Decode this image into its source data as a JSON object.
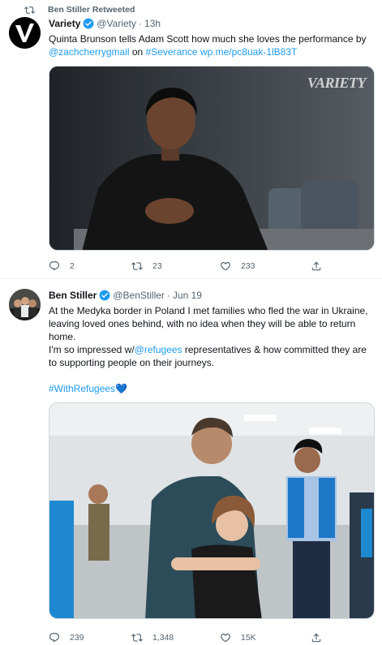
{
  "tweet1": {
    "retweet_context": "Ben Stiller Retweeted",
    "author_name": "Variety",
    "handle": "@Variety",
    "separator": "·",
    "time": "13h",
    "text_before": "Quinta Brunson tells Adam Scott how much she loves the performance by ",
    "mention": "@zachcherrygmail",
    "text_mid": " on ",
    "hashtag": "#Severance",
    "space": " ",
    "url": "wp.me/pc8uak-1lB83T",
    "media_watermark": "VARIETY",
    "replies": "2",
    "retweets": "23",
    "likes": "233",
    "avatar_letter": "V"
  },
  "tweet2": {
    "author_name": "Ben Stiller",
    "handle": "@BenStiller",
    "separator": "·",
    "time": "Jun 19",
    "paragraph1": "At the Medyka border in Poland I met families who fled the war in Ukraine, leaving loved ones behind, with no idea when they will be able to return home.",
    "p2_before": "I'm so impressed w/",
    "p2_mention": "@refugees",
    "p2_after": " representatives & how committed they are to supporting people on their journeys.",
    "hashtag": "#WithRefugees",
    "hashtag_emoji": "💙",
    "replies": "239",
    "retweets": "1,348",
    "likes": "15K"
  },
  "colors": {
    "link": "#1d9bf0",
    "secondary_text": "#536471",
    "verified": "#1d9bf0",
    "divider": "#eff3f4"
  },
  "icons": [
    "retweet-icon",
    "verified-badge-icon",
    "reply-icon",
    "like-icon",
    "share-icon"
  ]
}
